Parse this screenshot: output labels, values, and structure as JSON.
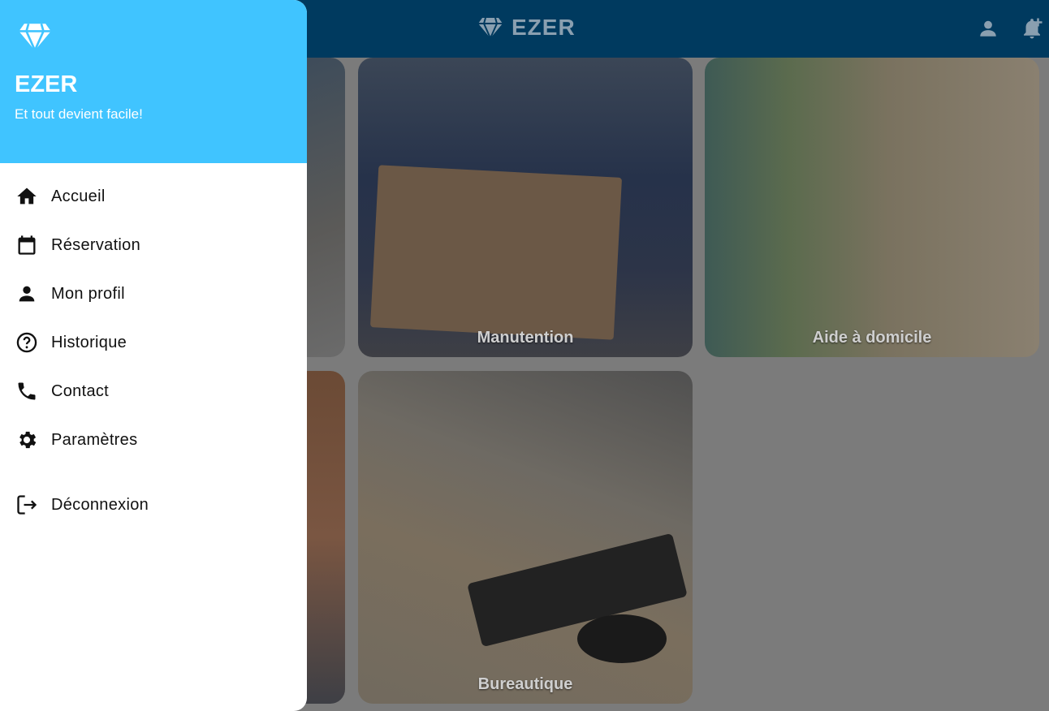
{
  "app_bar": {
    "brand": "EZER",
    "logo_icon": "diamond-icon",
    "actions": [
      {
        "name": "account-icon"
      },
      {
        "name": "notification-add-icon"
      }
    ]
  },
  "tiles": [
    {
      "label": ""
    },
    {
      "label": "Manutention"
    },
    {
      "label": "Aide à domicile"
    },
    {
      "label": ""
    },
    {
      "label": "Bureautique"
    }
  ],
  "drawer": {
    "logo_icon": "diamond-icon",
    "title": "EZER",
    "subtitle": "Et tout devient facile!",
    "header_color": "#40c4ff",
    "items": [
      {
        "label": "Accueil",
        "icon": "home-icon"
      },
      {
        "label": "Réservation",
        "icon": "calendar-icon"
      },
      {
        "label": "Mon profil",
        "icon": "person-icon"
      },
      {
        "label": "Historique",
        "icon": "help-circle-icon"
      },
      {
        "label": "Contact",
        "icon": "phone-icon"
      },
      {
        "label": "Paramètres",
        "icon": "gear-icon"
      }
    ],
    "logout": {
      "label": "Déconnexion",
      "icon": "logout-icon"
    }
  }
}
